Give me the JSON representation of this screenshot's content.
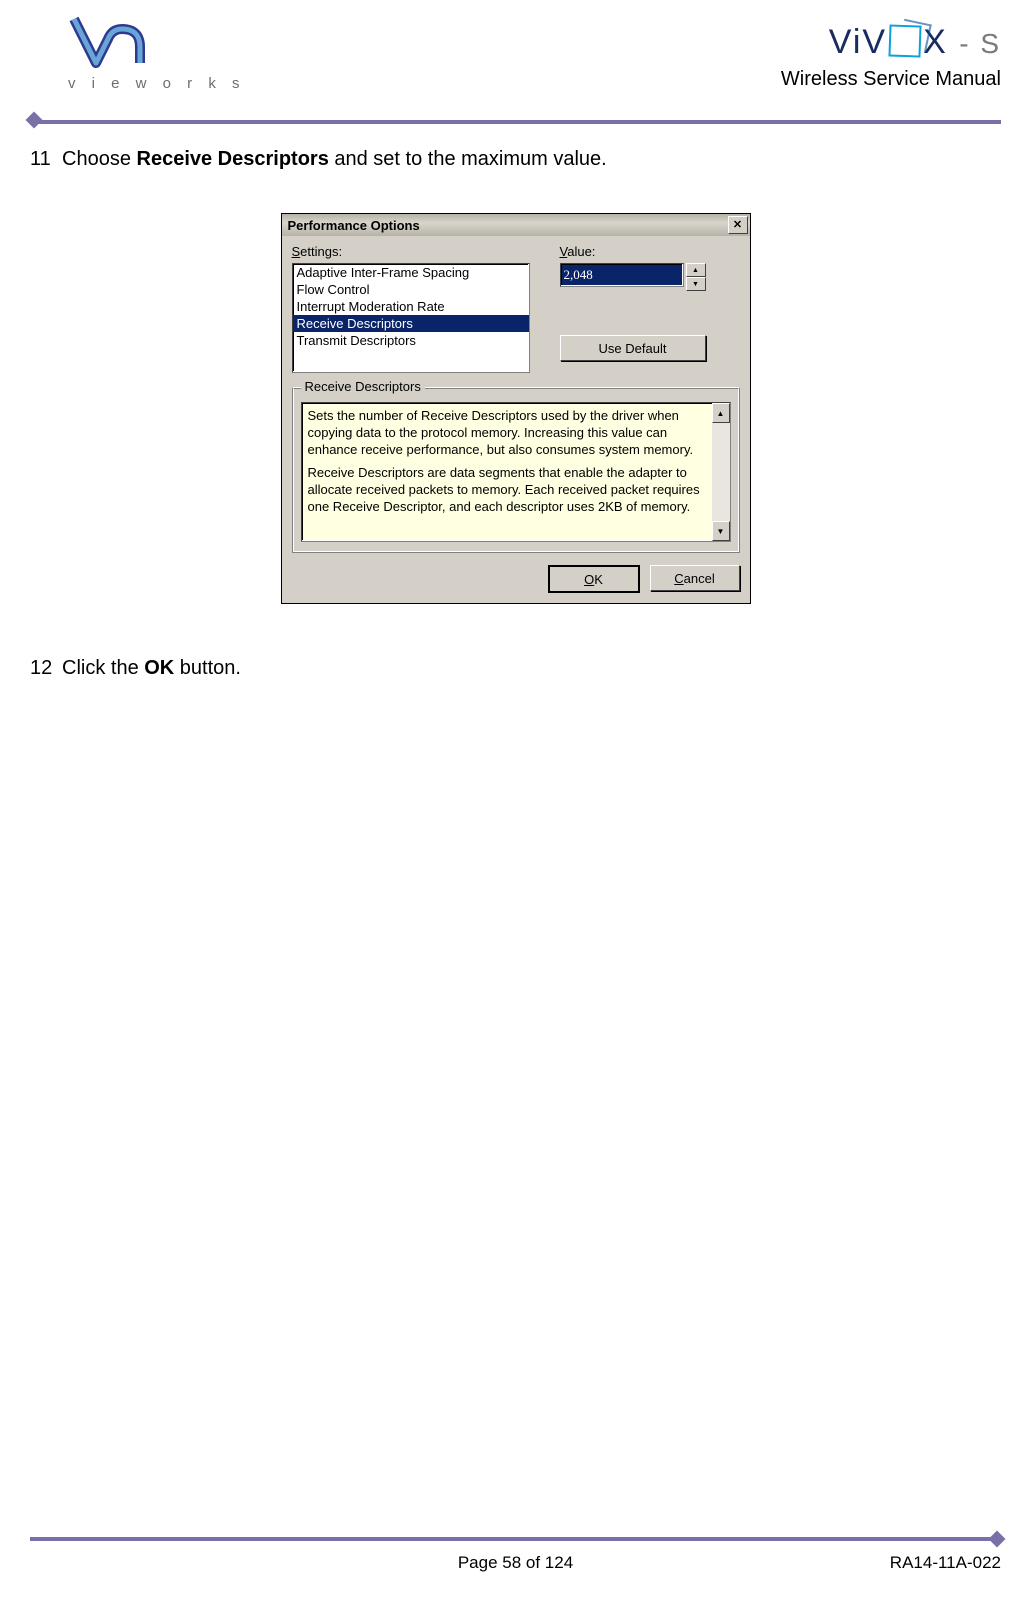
{
  "header": {
    "left_logo_text": "v i e w o r k s",
    "right_logo_text": "ViV X -S",
    "doc_title": "Wireless Service Manual"
  },
  "steps": {
    "s11_num": "11",
    "s11_pre": "Choose ",
    "s11_bold": "Receive Descriptors",
    "s11_post": " and set to the maximum value.",
    "s12_num": "12",
    "s12_pre": "Click the ",
    "s12_bold": "OK",
    "s12_post": " button."
  },
  "dialog": {
    "title": "Performance Options",
    "settings_label_u": "S",
    "settings_label_rest": "ettings:",
    "value_label_u": "V",
    "value_label_rest": "alue:",
    "list": {
      "i0": "Adaptive Inter-Frame Spacing",
      "i1": "Flow Control",
      "i2": "Interrupt Moderation Rate",
      "i3": "Receive Descriptors",
      "i4": "Transmit Descriptors"
    },
    "value_input": "2,048",
    "use_default": "Use Default",
    "group_label": "Receive Descriptors",
    "desc_p1": "Sets the number of Receive Descriptors used by the driver when copying data to the protocol memory. Increasing this value can enhance receive performance, but also consumes system memory.",
    "desc_p2": "Receive Descriptors are data segments that enable the adapter to allocate received packets to memory. Each received packet requires one Receive Descriptor, and each descriptor uses 2KB of memory.",
    "ok_u": "O",
    "ok_rest": "K",
    "cancel_u": "C",
    "cancel_rest": "ancel",
    "close_x": "✕"
  },
  "footer": {
    "page": "Page 58 of 124",
    "docnum": "RA14-11A-022"
  }
}
